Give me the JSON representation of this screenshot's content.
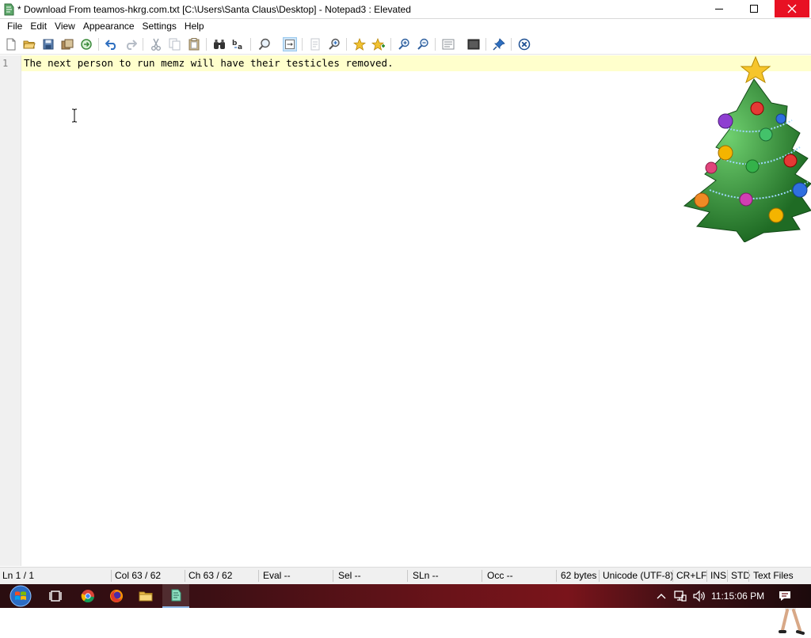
{
  "window": {
    "title": "* Download From teamos-hkrg.com.txt [C:\\Users\\Santa Claus\\Desktop] - Notepad3 : Elevated"
  },
  "menu": {
    "items": [
      "File",
      "Edit",
      "View",
      "Appearance",
      "Settings",
      "Help"
    ]
  },
  "toolbar": {
    "buttons": [
      {
        "name": "new-icon"
      },
      {
        "name": "open-icon"
      },
      {
        "name": "save-icon"
      },
      {
        "name": "save-as-icon"
      },
      {
        "name": "browse-icon"
      },
      {
        "name": "undo-icon"
      },
      {
        "name": "redo-icon"
      },
      {
        "name": "cut-icon"
      },
      {
        "name": "copy-icon"
      },
      {
        "name": "paste-icon"
      },
      {
        "name": "find-icon"
      },
      {
        "name": "replace-icon"
      },
      {
        "name": "find-next-icon"
      },
      {
        "name": "word-wrap-icon",
        "active": true
      },
      {
        "name": "goto-icon"
      },
      {
        "name": "find-in-files-icon"
      },
      {
        "name": "favorite-icon"
      },
      {
        "name": "add-favorite-icon"
      },
      {
        "name": "zoom-in-icon"
      },
      {
        "name": "zoom-out-icon"
      },
      {
        "name": "schema-icon"
      },
      {
        "name": "customize-icon"
      },
      {
        "name": "pin-icon"
      },
      {
        "name": "exit-icon"
      }
    ]
  },
  "editor": {
    "line_number": "1",
    "line_text": "The next person to run memz will have their testicles removed."
  },
  "statusbar": {
    "ln": "Ln  1 / 1",
    "col": "Col  63 / 62",
    "ch": "Ch  63 / 62",
    "eval": "Eval  --",
    "sel": "Sel  --",
    "sln": "SLn  --",
    "occ": "Occ  --",
    "size": "62 bytes",
    "encoding": "Unicode (UTF-8)",
    "eol": "CR+LF",
    "ins": "INS",
    "std": "STD",
    "lexer": "Text Files"
  },
  "taskbar": {
    "clock": "11:15:06 PM"
  },
  "colors": {
    "current_line": "#ffffcc",
    "close_button": "#e81123",
    "taskbar": "#6a1319"
  }
}
